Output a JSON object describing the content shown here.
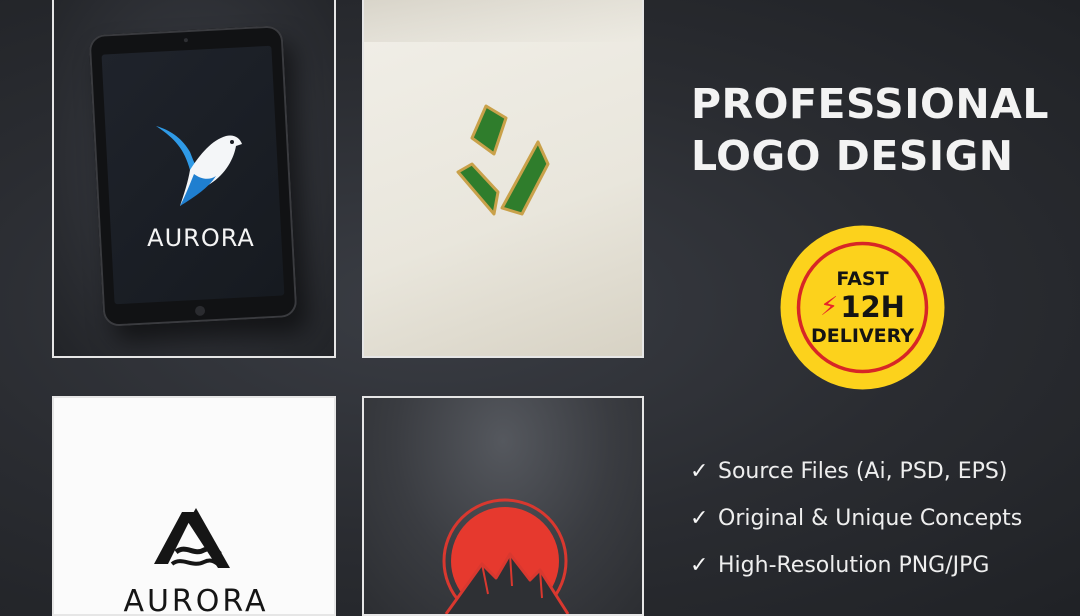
{
  "tiles": {
    "tablet_brand": "AURORA",
    "white_brand": "AURORA"
  },
  "heading": {
    "line1": "PROFESSIONAL",
    "line2": "LOGO DESIGN"
  },
  "badge": {
    "line1": "FAST",
    "line2": "12H",
    "line3": "DELIVERY",
    "icon": "lightning-icon",
    "colors": {
      "fill": "#fcd21c",
      "ring": "#d72626",
      "bolt": "#e8262a"
    }
  },
  "features": [
    {
      "label": "Source Files (Ai, PSD, EPS)",
      "icon": "check-icon"
    },
    {
      "label": "Original & Unique Concepts",
      "icon": "check-icon"
    },
    {
      "label": "High-Resolution PNG/JPG",
      "icon": "check-icon"
    }
  ],
  "colors": {
    "background": "#2a2c31",
    "text": "#f3f3f3",
    "leaf_green": "#2f7d2c",
    "leaf_gold": "#c9a14a",
    "bird_blue": "#2f9ae6",
    "sun_red": "#e6392e"
  }
}
